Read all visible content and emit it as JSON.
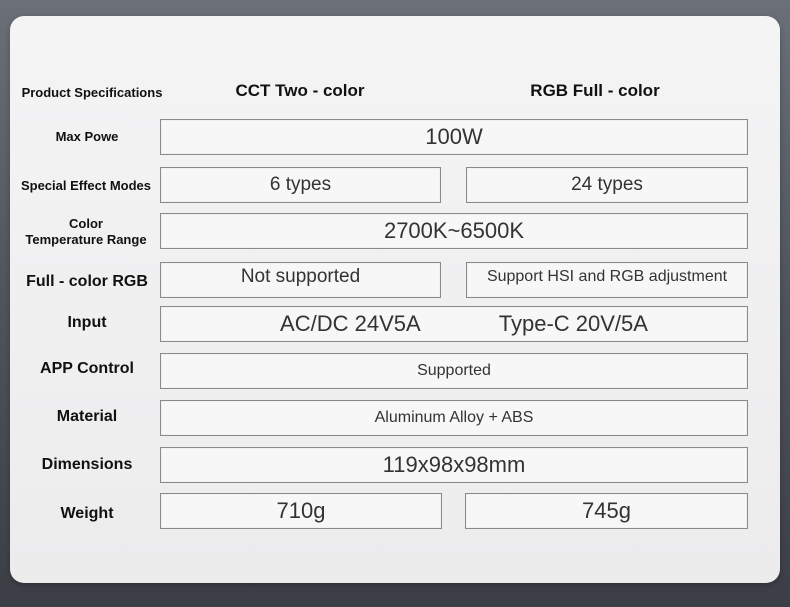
{
  "header": {
    "label": "Product Specifications",
    "col1": "CCT Two - color",
    "col2": "RGB Full - color"
  },
  "rows": {
    "max_power": {
      "label": "Max Powe",
      "value": "100W"
    },
    "effect_modes": {
      "label": "Special Effect Modes",
      "cct": "6 types",
      "rgb": "24 types"
    },
    "color_temp": {
      "label_line1": "Color",
      "label_line2": "Temperature Range",
      "value": "2700K~6500K"
    },
    "full_color": {
      "label": "Full - color RGB",
      "cct": "Not supported",
      "rgb": "Support HSI and RGB adjustment"
    },
    "input": {
      "label": "Input",
      "value1": "AC/DC 24V5A",
      "value2": "Type-C 20V/5A"
    },
    "app_control": {
      "label": "APP Control",
      "value": "Supported"
    },
    "material": {
      "label": "Material",
      "value": "Aluminum Alloy + ABS"
    },
    "dimensions": {
      "label": "Dimensions",
      "value": "119x98x98mm"
    },
    "weight": {
      "label": "Weight",
      "cct": "710g",
      "rgb": "745g"
    }
  }
}
